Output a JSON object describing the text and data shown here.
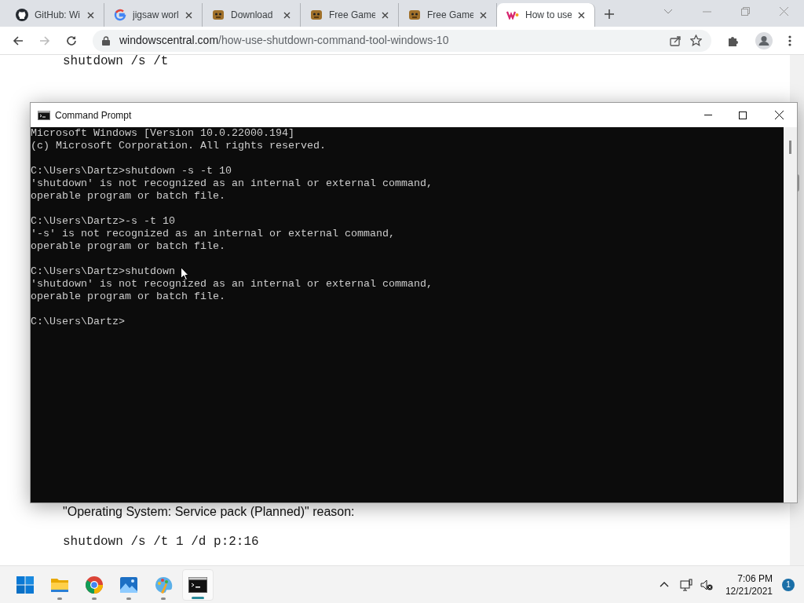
{
  "browser": {
    "tabs": [
      {
        "title": "GitHub: Wi",
        "selected": false
      },
      {
        "title": "jigsaw worl",
        "selected": false
      },
      {
        "title": "Download",
        "selected": false
      },
      {
        "title": "Free Game",
        "selected": false
      },
      {
        "title": "Free Game",
        "selected": false
      },
      {
        "title": "How to use",
        "selected": true
      }
    ],
    "address": {
      "domain": "windowscentral.com",
      "path": "/how-use-shutdown-command-tool-windows-10"
    }
  },
  "article": {
    "top": [
      {
        "kind": "code",
        "text": "shutdown /s /t"
      }
    ],
    "bottom": [
      {
        "kind": "para",
        "text": "\"Operating System: Service pack (Planned)\" reason:"
      },
      {
        "kind": "code",
        "text": "shutdown /s /t 1 /d p:2:16"
      }
    ]
  },
  "console": {
    "title": "Command Prompt",
    "blocks": [
      [
        "Microsoft Windows [Version 10.0.22000.194]",
        "(c) Microsoft Corporation. All rights reserved."
      ],
      [
        "C:\\Users\\Dartz>shutdown -s -t 10",
        "'shutdown' is not recognized as an internal or external command,",
        "operable program or batch file."
      ],
      [
        "C:\\Users\\Dartz>-s -t 10",
        "'-s' is not recognized as an internal or external command,",
        "operable program or batch file."
      ],
      [
        "C:\\Users\\Dartz>shutdown",
        "'shutdown' is not recognized as an internal or external command,",
        "operable program or batch file."
      ],
      [
        "C:\\Users\\Dartz>"
      ]
    ]
  },
  "taskbar": {
    "apps": [
      {
        "selected": false
      },
      {
        "selected": false
      },
      {
        "selected": false
      },
      {
        "selected": false
      },
      {
        "selected": false
      },
      {
        "selected": true
      }
    ],
    "time": "7:06 PM",
    "date": "12/21/2021",
    "notifications": "1"
  }
}
